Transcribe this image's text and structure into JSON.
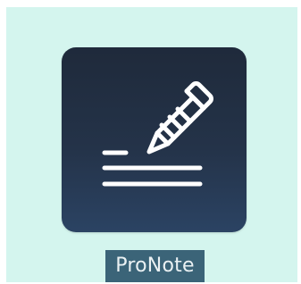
{
  "desktop": {
    "background_color": "#d4f5ee"
  },
  "app": {
    "name": "ProNote",
    "icon": "pencil-note-icon",
    "icon_gradient": [
      "#1f2a3b",
      "#2b4363"
    ],
    "label_background": "#3b6478",
    "glyph_color": "#ffffff"
  }
}
